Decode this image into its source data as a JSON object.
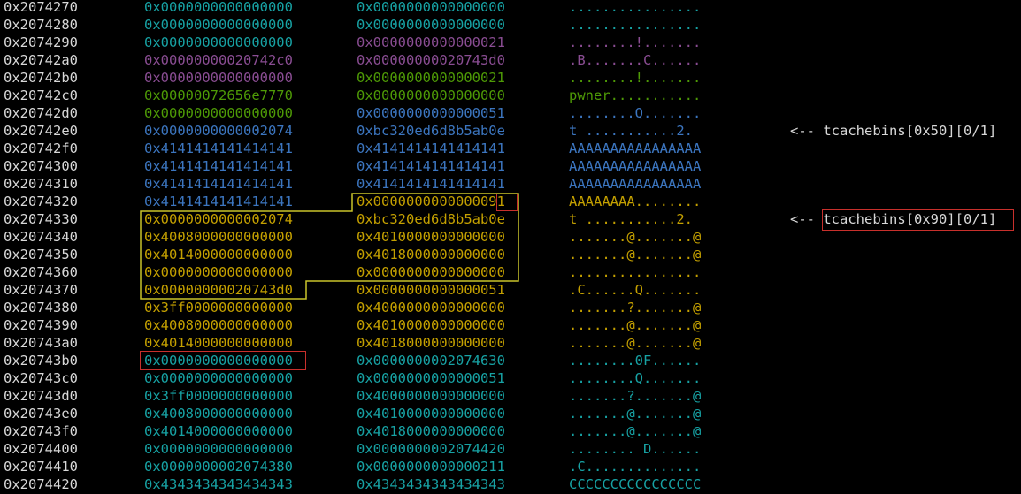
{
  "colors": {
    "address": "#d8d8d8",
    "cyan": "#17a2a4",
    "gray": "#7f8a8a",
    "purple": "#8a4d93",
    "green": "#4e9a06",
    "blue": "#3c76c0",
    "yellow": "#c4a000",
    "chunk_outline": "#c9c42a",
    "highlight_box": "#c8302c"
  },
  "rows": [
    {
      "addr": "0x2074270",
      "q1": "0x0000000000000000",
      "q2": "0x0000000000000000",
      "ascii": "................",
      "c1": "cyan",
      "c2": "cyan",
      "c3": "cyan"
    },
    {
      "addr": "0x2074280",
      "q1": "0x0000000000000000",
      "q2": "0x0000000000000000",
      "ascii": "................",
      "c1": "cyan",
      "c2": "cyan",
      "c3": "cyan"
    },
    {
      "addr": "0x2074290",
      "q1": "0x0000000000000000",
      "q2": "0x0000000000000021",
      "ascii": "........!.......",
      "c1": "cyan",
      "c2": "purple",
      "c3": "purple"
    },
    {
      "addr": "0x20742a0",
      "q1": "0x00000000020742c0",
      "q2": "0x00000000020743d0",
      "ascii": ".B.......C......",
      "c1": "purple",
      "c2": "purple",
      "c3": "purple"
    },
    {
      "addr": "0x20742b0",
      "q1": "0x0000000000000000",
      "q2": "0x0000000000000021",
      "ascii": "........!.......",
      "c1": "purple",
      "c2": "green",
      "c3": "green"
    },
    {
      "addr": "0x20742c0",
      "q1": "0x00000072656e7770",
      "q2": "0x0000000000000000",
      "ascii": "pwner...........",
      "c1": "green",
      "c2": "green",
      "c3": "green"
    },
    {
      "addr": "0x20742d0",
      "q1": "0x0000000000000000",
      "q2": "0x0000000000000051",
      "ascii": "........Q.......",
      "c1": "green",
      "c2": "blue",
      "c3": "blue"
    },
    {
      "addr": "0x20742e0",
      "q1": "0x0000000000002074",
      "q2": "0xbc320ed6d8b5ab0e",
      "ascii": "t ...........2.",
      "c1": "blue",
      "c2": "blue",
      "c3": "blue",
      "anno": "<-- tcachebins[0x50][0/1]"
    },
    {
      "addr": "0x20742f0",
      "q1": "0x4141414141414141",
      "q2": "0x4141414141414141",
      "ascii": "AAAAAAAAAAAAAAAA",
      "c1": "blue",
      "c2": "blue",
      "c3": "blue"
    },
    {
      "addr": "0x2074300",
      "q1": "0x4141414141414141",
      "q2": "0x4141414141414141",
      "ascii": "AAAAAAAAAAAAAAAA",
      "c1": "blue",
      "c2": "blue",
      "c3": "blue"
    },
    {
      "addr": "0x2074310",
      "q1": "0x4141414141414141",
      "q2": "0x4141414141414141",
      "ascii": "AAAAAAAAAAAAAAAA",
      "c1": "blue",
      "c2": "blue",
      "c3": "blue"
    },
    {
      "addr": "0x2074320",
      "q1": "0x4141414141414141",
      "q2": "0x0000000000000091",
      "ascii": "AAAAAAAA........",
      "c1": "blue",
      "c2": "yellow",
      "c3": "yellow"
    },
    {
      "addr": "0x2074330",
      "q1": "0x0000000000002074",
      "q2": "0xbc320ed6d8b5ab0e",
      "ascii": "t ...........2.",
      "c1": "yellow",
      "c2": "yellow",
      "c3": "yellow",
      "anno": "<-- tcachebins[0x90][0/1]"
    },
    {
      "addr": "0x2074340",
      "q1": "0x4008000000000000",
      "q2": "0x4010000000000000",
      "ascii": ".......@.......@",
      "c1": "yellow",
      "c2": "yellow",
      "c3": "yellow"
    },
    {
      "addr": "0x2074350",
      "q1": "0x4014000000000000",
      "q2": "0x4018000000000000",
      "ascii": ".......@.......@",
      "c1": "yellow",
      "c2": "yellow",
      "c3": "yellow"
    },
    {
      "addr": "0x2074360",
      "q1": "0x0000000000000000",
      "q2": "0x0000000000000000",
      "ascii": "................",
      "c1": "yellow",
      "c2": "yellow",
      "c3": "yellow"
    },
    {
      "addr": "0x2074370",
      "q1": "0x00000000020743d0",
      "q2": "0x0000000000000051",
      "ascii": ".C......Q.......",
      "c1": "yellow",
      "c2": "yellow",
      "c3": "yellow"
    },
    {
      "addr": "0x2074380",
      "q1": "0x3ff0000000000000",
      "q2": "0x4000000000000000",
      "ascii": ".......?.......@",
      "c1": "yellow",
      "c2": "yellow",
      "c3": "yellow"
    },
    {
      "addr": "0x2074390",
      "q1": "0x4008000000000000",
      "q2": "0x4010000000000000",
      "ascii": ".......@.......@",
      "c1": "yellow",
      "c2": "yellow",
      "c3": "yellow"
    },
    {
      "addr": "0x20743a0",
      "q1": "0x4014000000000000",
      "q2": "0x4018000000000000",
      "ascii": ".......@.......@",
      "c1": "yellow",
      "c2": "yellow",
      "c3": "yellow"
    },
    {
      "addr": "0x20743b0",
      "q1": "0x0000000000000000",
      "q2": "0x0000000002074630",
      "ascii": "........0F......",
      "c1": "cyan",
      "c2": "cyan",
      "c3": "cyan"
    },
    {
      "addr": "0x20743c0",
      "q1": "0x0000000000000000",
      "q2": "0x0000000000000051",
      "ascii": "........Q.......",
      "c1": "cyan",
      "c2": "cyan",
      "c3": "cyan"
    },
    {
      "addr": "0x20743d0",
      "q1": "0x3ff0000000000000",
      "q2": "0x4000000000000000",
      "ascii": ".......?.......@",
      "c1": "cyan",
      "c2": "cyan",
      "c3": "cyan"
    },
    {
      "addr": "0x20743e0",
      "q1": "0x4008000000000000",
      "q2": "0x4010000000000000",
      "ascii": ".......@.......@",
      "c1": "cyan",
      "c2": "cyan",
      "c3": "cyan"
    },
    {
      "addr": "0x20743f0",
      "q1": "0x4014000000000000",
      "q2": "0x4018000000000000",
      "ascii": ".......@.......@",
      "c1": "cyan",
      "c2": "cyan",
      "c3": "cyan"
    },
    {
      "addr": "0x2074400",
      "q1": "0x0000000000000000",
      "q2": "0x0000000002074420",
      "ascii": "........ D......",
      "c1": "cyan",
      "c2": "cyan",
      "c3": "cyan"
    },
    {
      "addr": "0x2074410",
      "q1": "0x0000000002074380",
      "q2": "0x0000000000000211",
      "ascii": ".C..............",
      "c1": "cyan",
      "c2": "cyan",
      "c3": "cyan"
    },
    {
      "addr": "0x2074420",
      "q1": "0x4343434343434343",
      "q2": "0x4343434343434343",
      "ascii": "CCCCCCCCCCCCCCCC",
      "c1": "cyan",
      "c2": "cyan",
      "c3": "cyan"
    }
  ]
}
